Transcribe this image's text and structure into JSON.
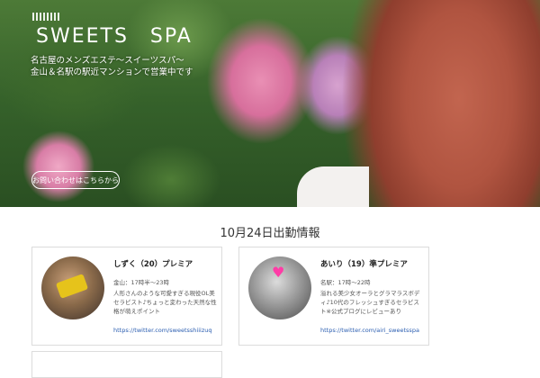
{
  "hero": {
    "brand": "SWEETS　SPA",
    "tagline_line1": "名古屋のメンズエステ〜スイーツスパ〜",
    "tagline_line2": "金山＆名駅の駅近マンションで営業中です",
    "contact_button": "お問い合わせはこちらから"
  },
  "schedule": {
    "title": "10月24日出勤情報",
    "therapists": [
      {
        "name": "しずく（20）プレミア",
        "hours": "金山：17時半〜23時",
        "description": "人形さんのような可愛すぎる現役OL美セラピスト♪ちょっと変わった天然な性格が萌えポイント",
        "link": "https://twitter.com/sweetsshiiizuq"
      },
      {
        "name": "あいり（19）準プレミア",
        "hours": "名駅：17時〜22時",
        "description": "溢れる美少女オーラとグラマラスボディ♪10代のフレッシュすぎるセラピスト※公式ブログにレビューあり",
        "link": "https://twitter.com/airi_sweetsspa"
      }
    ]
  }
}
